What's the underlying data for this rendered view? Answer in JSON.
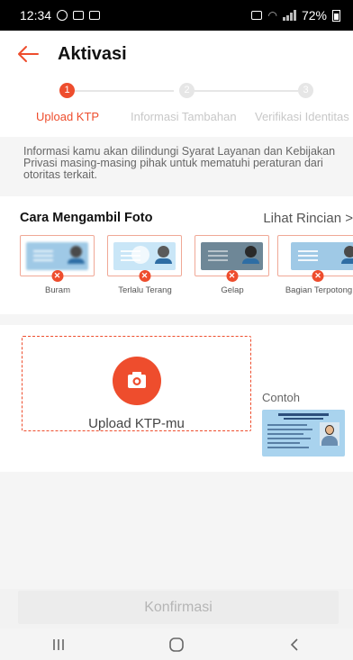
{
  "status_bar": {
    "time": "12:34",
    "battery": "72%"
  },
  "header": {
    "title": "Aktivasi"
  },
  "stepper": {
    "steps": [
      {
        "number": "1",
        "label": "Upload KTP",
        "active": true
      },
      {
        "number": "2",
        "label": "Informasi Tambahan",
        "active": false
      },
      {
        "number": "3",
        "label": "Verifikasi Identitas",
        "active": false
      }
    ]
  },
  "info": {
    "text": "Informasi kamu akan dilindungi Syarat Layanan dan Kebijakan Privasi masing-masing pihak untuk mematuhi peraturan dari otoritas terkait."
  },
  "howto": {
    "title": "Cara Mengambil Foto",
    "details_link": "Lihat Rincian >",
    "examples": [
      {
        "label": "Buram"
      },
      {
        "label": "Terlalu Terang"
      },
      {
        "label": "Gelap"
      },
      {
        "label": "Bagian Terpotong"
      }
    ]
  },
  "upload": {
    "label": "Upload KTP-mu"
  },
  "sample": {
    "label": "Contoh",
    "card_header": "PROVINSI JAWA BARAT",
    "card_subheader": "KABUPATEN BANDUNG"
  },
  "footer": {
    "confirm_label": "Konfirmasi"
  },
  "colors": {
    "accent": "#ee4d2d",
    "disabled_text": "#b5b5b5"
  },
  "icons": {
    "back": "arrow-left-icon",
    "camera": "camera-icon",
    "nav_recent": "recent-apps-icon",
    "nav_home": "home-icon",
    "nav_back": "back-icon"
  }
}
